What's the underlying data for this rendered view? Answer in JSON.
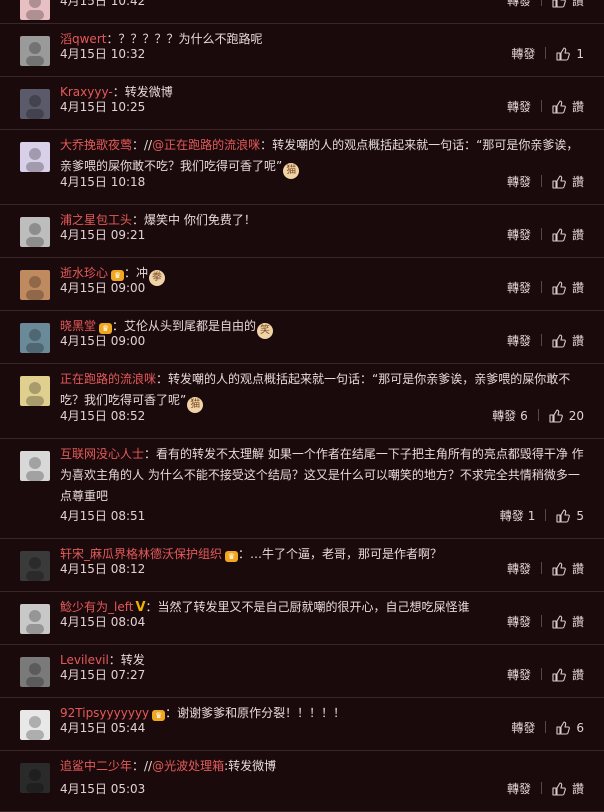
{
  "comments": [
    {
      "user": "",
      "content": "",
      "time": "4月15日 10:42",
      "repost_label": "轉發",
      "repost_count": "",
      "like_label": "讚",
      "like_count": "",
      "badge": "",
      "avatar_color": "#e8c0c4"
    },
    {
      "user": "滔qwert",
      "content": "：？？？？？为什么不跑路呢",
      "time": "4月15日 10:32",
      "repost_label": "轉發",
      "repost_count": "",
      "like_label": "",
      "like_count": "1",
      "badge": "",
      "avatar_color": "#9a9a9a"
    },
    {
      "user": "Kraxyyy-",
      "content": "：转发微博",
      "time": "4月15日 10:25",
      "repost_label": "轉發",
      "repost_count": "",
      "like_label": "讚",
      "like_count": "",
      "badge": "",
      "avatar_color": "#5a5a6a"
    },
    {
      "user": "大乔挽歌夜莺",
      "content_pre": "：//",
      "mention": "@正在跑路的流浪咪",
      "content": "：转发嘲的人的观点概括起来就一句话：“那可是你亲爹诶，亲爹喂的屎你敢不吃？我们吃得可香了呢”",
      "time": "4月15日 10:18",
      "repost_label": "轉發",
      "repost_count": "",
      "like_label": "讚",
      "like_count": "",
      "badge": "",
      "emoji": "猫",
      "avatar_color": "#d8cfe8"
    },
    {
      "user": "浦之星包工头",
      "content": "：爆笑中 你们免费了！",
      "time": "4月15日 09:21",
      "repost_label": "轉發",
      "repost_count": "",
      "like_label": "讚",
      "like_count": "",
      "badge": "",
      "avatar_color": "#bdbdbd"
    },
    {
      "user": "逝水珍心",
      "content": "：冲",
      "time": "4月15日 09:00",
      "repost_label": "轉發",
      "repost_count": "",
      "like_label": "讚",
      "like_count": "",
      "badge": "vip",
      "emoji": "拳",
      "avatar_color": "#c08a60"
    },
    {
      "user": "晓黑堂",
      "content": "：艾伦从头到尾都是自由的",
      "time": "4月15日 09:00",
      "repost_label": "轉發",
      "repost_count": "",
      "like_label": "讚",
      "like_count": "",
      "badge": "vip",
      "emoji": "笑",
      "avatar_color": "#6a8a9a"
    },
    {
      "user": "正在跑路的流浪咪",
      "content": "：转发嘲的人的观点概括起来就一句话：“那可是你亲爹诶，亲爹喂的屎你敢不吃？我们吃得可香了呢”",
      "time": "4月15日 08:52",
      "repost_label": "轉發",
      "repost_count": "6",
      "like_label": "",
      "like_count": "20",
      "badge": "",
      "emoji": "猫",
      "avatar_color": "#e0d090"
    },
    {
      "user": "互联网没心人士",
      "content": "：看有的转发不太理解 如果一个作者在结尾一下子把主角所有的亮点都毁得干净 作为喜欢主角的人 为什么不能不接受这个结局？这又是什么可以嘲笑的地方？不求完全共情稍微多一点尊重吧",
      "time": "4月15日 08:51",
      "repost_label": "轉發",
      "repost_count": "1",
      "like_label": "",
      "like_count": "5",
      "badge": "",
      "avatar_color": "#d8d8d8"
    },
    {
      "user": "轩宋_麻瓜界格林德沃保护组织",
      "content": "：…牛了个逼，老哥，那可是作者啊？",
      "time": "4月15日 08:12",
      "repost_label": "轉發",
      "repost_count": "",
      "like_label": "讚",
      "like_count": "",
      "badge": "vip",
      "avatar_color": "#3a3a3a"
    },
    {
      "user": "鲶少有为_left",
      "content": "：当然了转发里又不是自己厨就嘲的很开心，自己想吃屎怪谁",
      "time": "4月15日 08:04",
      "repost_label": "轉發",
      "repost_count": "",
      "like_label": "讚",
      "like_count": "",
      "badge": "v",
      "avatar_color": "#c8c8c8"
    },
    {
      "user": "Levilevil",
      "content": "：转发",
      "time": "4月15日 07:27",
      "repost_label": "轉發",
      "repost_count": "",
      "like_label": "讚",
      "like_count": "",
      "badge": "",
      "avatar_color": "#7a7a7a"
    },
    {
      "user": "92Tipsyyyyyyy",
      "content": "：谢谢爹爹和原作分裂！！！！！",
      "time": "4月15日 05:44",
      "repost_label": "轉發",
      "repost_count": "",
      "like_label": "",
      "like_count": "6",
      "badge": "vip",
      "avatar_color": "#e8e8e8"
    },
    {
      "user": "追鲨中二少年",
      "content_pre": "：//",
      "mention": "@光波处理箱",
      "content": ":转发微博",
      "time": "4月15日 05:03",
      "repost_label": "轉發",
      "repost_count": "",
      "like_label": "讚",
      "like_count": "",
      "badge": "",
      "avatar_color": "#2a2a2a"
    }
  ]
}
